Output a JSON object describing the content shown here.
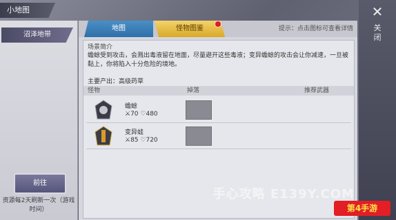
{
  "window": {
    "title": "小地图"
  },
  "left": {
    "region": "沼泽地带",
    "goto_label": "前往",
    "refresh_note": "资源每2天刷新一次（游戏时间）"
  },
  "tabs": [
    {
      "label": "地图",
      "active": false
    },
    {
      "label": "怪物图鉴",
      "active": true
    }
  ],
  "hint": "提示：点击图标可查看详情",
  "scene": {
    "title": "场景简介",
    "intro": "蟾蜍受到攻击，会溅出毒液留在地面，尽量避开这些毒液；变异蟾蜍的攻击会让你减速，一旦被黏上，你将陷入十分危险的境地。",
    "drop": "主要产出：高级药草"
  },
  "columns": {
    "monster": "怪物",
    "loot": "掉落",
    "weapon": "推荐武器"
  },
  "monsters": [
    {
      "name": "蟾蜍",
      "attack": "70",
      "hp": "480"
    },
    {
      "name": "变异蛙",
      "attack": "85",
      "hp": "720"
    }
  ],
  "close": {
    "icon": "close-icon",
    "label": "关闭"
  },
  "watermark": "手心攻略 E139Y.COM",
  "logo_text": "第4手游"
}
